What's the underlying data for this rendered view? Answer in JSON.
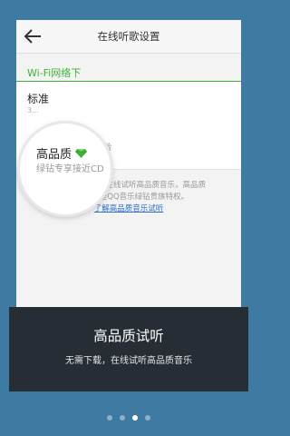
{
  "header": {
    "title": "在线听歌设置",
    "back_icon": "arrow-left-icon"
  },
  "section": {
    "title": "Wi-Fi网络下"
  },
  "options": [
    {
      "label": "标准",
      "desc": "3..."
    },
    {
      "label": "高品质",
      "desc": "质体验"
    }
  ],
  "magnifier": {
    "label": "高品质",
    "desc": "绿钻专享接近CD",
    "badge_icon": "diamond-icon"
  },
  "description": {
    "line1": "无需下载，直接在线试听高品质音乐，高品质",
    "line2": "在线试听是QQ音乐绿钻贵族特权。",
    "link": "了解高品质音乐试听"
  },
  "overlay": {
    "title": "高品质试听",
    "subtitle": "无需下载，在线试听高品质音乐"
  },
  "pager": {
    "count": 4,
    "active_index": 2
  },
  "colors": {
    "background": "#3f7aa3",
    "accent_green": "#3fb137",
    "link_blue": "#2f6ec7",
    "overlay": "#262d35"
  }
}
